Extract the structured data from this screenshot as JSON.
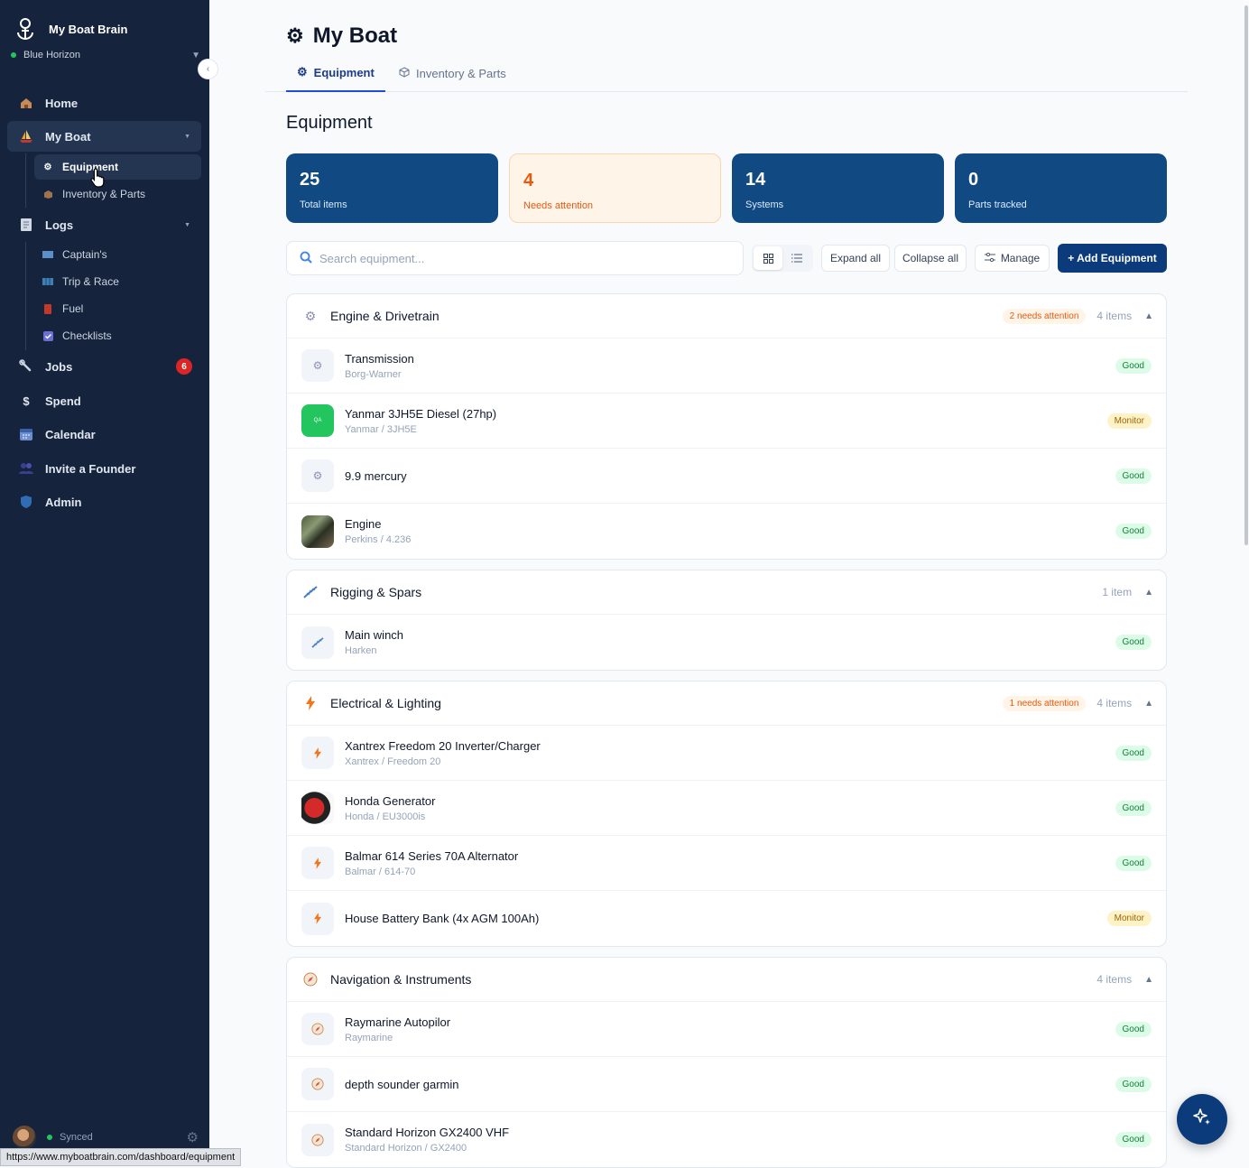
{
  "brand": {
    "name": "My Boat Brain",
    "boat_name": "Blue Horizon"
  },
  "nav": {
    "home": "Home",
    "my_boat": "My Boat",
    "equipment": "Equipment",
    "inventory": "Inventory & Parts",
    "logs": "Logs",
    "captains": "Captain's",
    "trip": "Trip & Race",
    "fuel": "Fuel",
    "checklists": "Checklists",
    "jobs": "Jobs",
    "jobs_badge": "6",
    "spend": "Spend",
    "calendar": "Calendar",
    "invite": "Invite a Founder",
    "admin": "Admin"
  },
  "footer": {
    "sync_status": "Synced"
  },
  "status_url": "https://www.myboatbrain.com/dashboard/equipment",
  "page": {
    "title": "My Boat",
    "tab_equipment": "Equipment",
    "tab_inventory": "Inventory & Parts",
    "section_title": "Equipment"
  },
  "stats": [
    {
      "value": "25",
      "label": "Total items"
    },
    {
      "value": "4",
      "label": "Needs attention"
    },
    {
      "value": "14",
      "label": "Systems"
    },
    {
      "value": "0",
      "label": "Parts tracked"
    }
  ],
  "toolbar": {
    "search_placeholder": "Search equipment...",
    "expand_all": "Expand all",
    "collapse_all": "Collapse all",
    "manage": "Manage",
    "add_equipment": "+ Add Equipment"
  },
  "groups": [
    {
      "name": "Engine & Drivetrain",
      "attention": "2 needs attention",
      "count": "4 items",
      "items": [
        {
          "name": "Transmission",
          "sub": "Borg-Warner",
          "status": "Good"
        },
        {
          "name": "Yanmar 3JH5E Diesel (27hp)",
          "sub": "Yanmar / 3JH5E",
          "status": "Monitor",
          "thumb_text": "QA"
        },
        {
          "name": "9.9 mercury",
          "sub": "",
          "status": "Good"
        },
        {
          "name": "Engine",
          "sub": "Perkins / 4.236",
          "status": "Good"
        }
      ]
    },
    {
      "name": "Rigging & Spars",
      "attention": "",
      "count": "1 item",
      "items": [
        {
          "name": "Main winch",
          "sub": "Harken",
          "status": "Good"
        }
      ]
    },
    {
      "name": "Electrical & Lighting",
      "attention": "1 needs attention",
      "count": "4 items",
      "items": [
        {
          "name": "Xantrex Freedom 20 Inverter/Charger",
          "sub": "Xantrex / Freedom 20",
          "status": "Good"
        },
        {
          "name": "Honda Generator",
          "sub": "Honda / EU3000is",
          "status": "Good"
        },
        {
          "name": "Balmar 614 Series 70A Alternator",
          "sub": "Balmar / 614-70",
          "status": "Good"
        },
        {
          "name": "House Battery Bank (4x AGM 100Ah)",
          "sub": "",
          "status": "Monitor"
        }
      ]
    },
    {
      "name": "Navigation & Instruments",
      "attention": "",
      "count": "4 items",
      "items": [
        {
          "name": "Raymarine Autopilor",
          "sub": "Raymarine",
          "status": "Good"
        },
        {
          "name": "depth sounder garmin",
          "sub": "",
          "status": "Good"
        },
        {
          "name": "Standard Horizon GX2400 VHF",
          "sub": "Standard Horizon / GX2400",
          "status": "Good"
        }
      ]
    }
  ]
}
